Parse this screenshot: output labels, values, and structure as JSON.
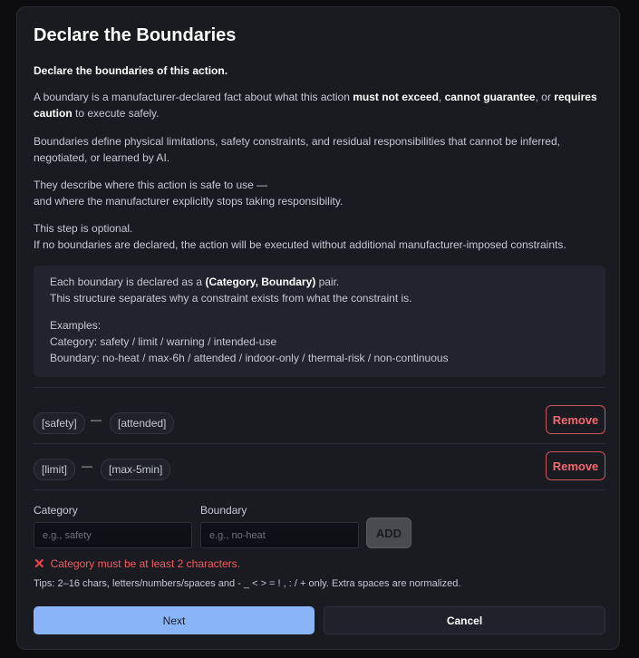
{
  "dialog": {
    "title": "Declare the Boundaries",
    "subtitle": "Declare the boundaries of this action.",
    "p1": {
      "a": "A boundary is a manufacturer-declared fact about what this action ",
      "b": "must not exceed",
      "c": ", ",
      "d": "cannot guarantee",
      "e": ", or ",
      "f": "requires",
      "g": "caution",
      "h": " to execute safely."
    },
    "p2_line1": "Boundaries define physical limitations, safety constraints, and residual responsibilities that cannot be inferred,",
    "p2_line2": "negotiated, or learned by AI.",
    "p3_line1": "They describe where this action is safe to use —",
    "p3_line2": "and where the manufacturer explicitly stops taking responsibility.",
    "p4_line1": "This step is optional.",
    "p4_line2": "If no boundaries are declared, the action will be executed without additional manufacturer-imposed constraints."
  },
  "info": {
    "line1_a": "Each boundary is declared as a ",
    "line1_b": "(Category, Boundary)",
    "line1_c": " pair.",
    "line2": "This structure separates why a constraint exists from what the constraint is.",
    "examples_heading": "Examples:",
    "examples_category": "Category: safety / limit / warning / intended-use",
    "examples_boundary": "Boundary: no-heat / max-6h / attended / indoor-only / thermal-risk / non-continuous"
  },
  "boundaries": [
    {
      "category": "[safety]",
      "separator": "—",
      "boundary": "[attended]",
      "remove_label": "Remove"
    },
    {
      "category": "[limit]",
      "separator": "—",
      "boundary": "[max-5min]",
      "remove_label": "Remove"
    }
  ],
  "form": {
    "category_label": "Category",
    "category_placeholder": "e.g., safety",
    "category_value": "",
    "boundary_label": "Boundary",
    "boundary_placeholder": "e.g., no-heat",
    "boundary_value": "",
    "add_label": "ADD",
    "error_icon": "x-mark-icon",
    "error_text": "Category must be at least 2 characters.",
    "tips": "Tips: 2–16 chars, letters/numbers/spaces and - _ < > = ! , : / + only. Extra spaces are normalized."
  },
  "footer": {
    "next_label": "Next",
    "cancel_label": "Cancel"
  },
  "colors": {
    "accent": "#8ab4f8",
    "danger": "#f05a63",
    "panel": "#1a1b21"
  }
}
